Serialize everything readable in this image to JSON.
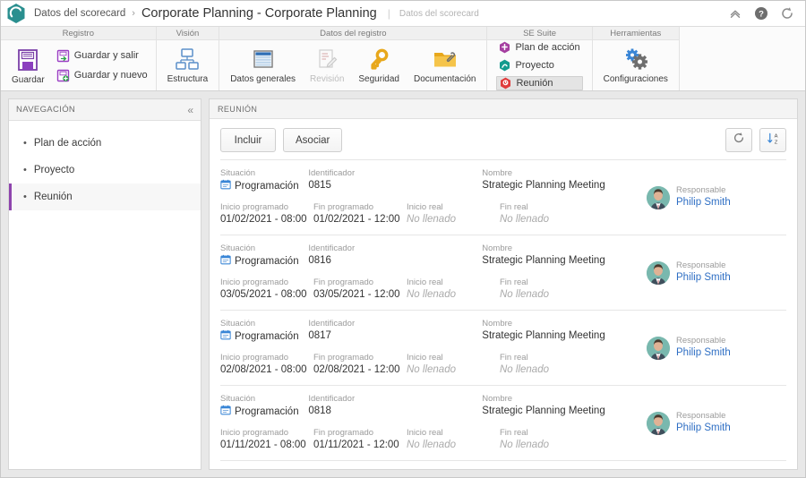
{
  "window": {
    "breadcrumb_root": "Datos del scorecard",
    "breadcrumb_sep": "›",
    "title": "Corporate Planning - Corporate Planning",
    "subtitle": "Datos del scorecard",
    "icons": {
      "collapse": "chevron-up-icon",
      "help": "help-icon",
      "refresh": "refresh-icon"
    }
  },
  "ribbon": {
    "groups": [
      {
        "title": "Registro",
        "big": [
          {
            "label": "Guardar",
            "icon": "save-icon",
            "disabled": false
          }
        ],
        "small": [
          {
            "label": "Guardar y salir",
            "icon": "save-and-exit-icon"
          },
          {
            "label": "Guardar y nuevo",
            "icon": "save-and-new-icon"
          }
        ]
      },
      {
        "title": "Visión",
        "big": [
          {
            "label": "Estructura",
            "icon": "structure-icon",
            "disabled": false
          }
        ],
        "small": []
      },
      {
        "title": "Datos del registro",
        "big": [
          {
            "label": "Datos generales",
            "icon": "general-data-icon",
            "disabled": false
          },
          {
            "label": "Revisión",
            "icon": "revision-icon",
            "disabled": true
          },
          {
            "label": "Seguridad",
            "icon": "security-key-icon",
            "disabled": false
          },
          {
            "label": "Documentación",
            "icon": "documentation-folder-icon",
            "disabled": false
          }
        ],
        "small": []
      },
      {
        "title": "SE Suite",
        "big": [],
        "small": [
          {
            "label": "Plan de acción",
            "icon": "action-plan-hex-icon",
            "color": "#a53fa0",
            "selected": false
          },
          {
            "label": "Proyecto",
            "icon": "project-hex-icon",
            "color": "#149b8e",
            "selected": false
          },
          {
            "label": "Reunión",
            "icon": "meeting-hex-icon",
            "color": "#e03b3b",
            "selected": true
          }
        ]
      },
      {
        "title": "Herramientas",
        "big": [
          {
            "label": "Configuraciones",
            "icon": "settings-gears-icon",
            "disabled": false
          }
        ],
        "small": []
      }
    ]
  },
  "sidebar": {
    "title": "NAVEGACIÓN",
    "collapse_icon": "double-chevron-left-icon",
    "items": [
      {
        "label": "Plan de acción",
        "active": false
      },
      {
        "label": "Proyecto",
        "active": false
      },
      {
        "label": "Reunión",
        "active": true
      }
    ]
  },
  "panel": {
    "title": "REUNIÓN",
    "buttons": {
      "include": "Incluir",
      "associate": "Asociar"
    },
    "tools": {
      "refresh": "refresh-icon",
      "sort": "sort-descending-icon"
    },
    "labels": {
      "situacion": "Situación",
      "identificador": "Identificador",
      "nombre": "Nombre",
      "inicio_programado": "Inicio programado",
      "fin_programado": "Fin programado",
      "inicio_real": "Inicio real",
      "fin_real": "Fin real",
      "responsable": "Responsable"
    },
    "rows": [
      {
        "situacion": "Programación",
        "situacion_icon": "calendar-icon",
        "identificador": "0815",
        "nombre": "Strategic Planning Meeting",
        "inicio_programado": "01/02/2021 - 08:00",
        "fin_programado": "01/02/2021 - 12:00",
        "inicio_real": "No llenado",
        "fin_real": "No llenado",
        "responsable": "Philip Smith"
      },
      {
        "situacion": "Programación",
        "situacion_icon": "calendar-icon",
        "identificador": "0816",
        "nombre": "Strategic Planning Meeting",
        "inicio_programado": "03/05/2021 - 08:00",
        "fin_programado": "03/05/2021 - 12:00",
        "inicio_real": "No llenado",
        "fin_real": "No llenado",
        "responsable": "Philip Smith"
      },
      {
        "situacion": "Programación",
        "situacion_icon": "calendar-icon",
        "identificador": "0817",
        "nombre": "Strategic Planning Meeting",
        "inicio_programado": "02/08/2021 - 08:00",
        "fin_programado": "02/08/2021 - 12:00",
        "inicio_real": "No llenado",
        "fin_real": "No llenado",
        "responsable": "Philip Smith"
      },
      {
        "situacion": "Programación",
        "situacion_icon": "calendar-icon",
        "identificador": "0818",
        "nombre": "Strategic Planning Meeting",
        "inicio_programado": "01/11/2021 - 08:00",
        "fin_programado": "01/11/2021 - 12:00",
        "inicio_real": "No llenado",
        "fin_real": "No llenado",
        "responsable": "Philip Smith"
      }
    ]
  },
  "colors": {
    "accent_purple": "#8e44ad",
    "logo_teal": "#2a8f8f",
    "link_blue": "#2f6fc4",
    "selected_red": "#e03b3b"
  }
}
